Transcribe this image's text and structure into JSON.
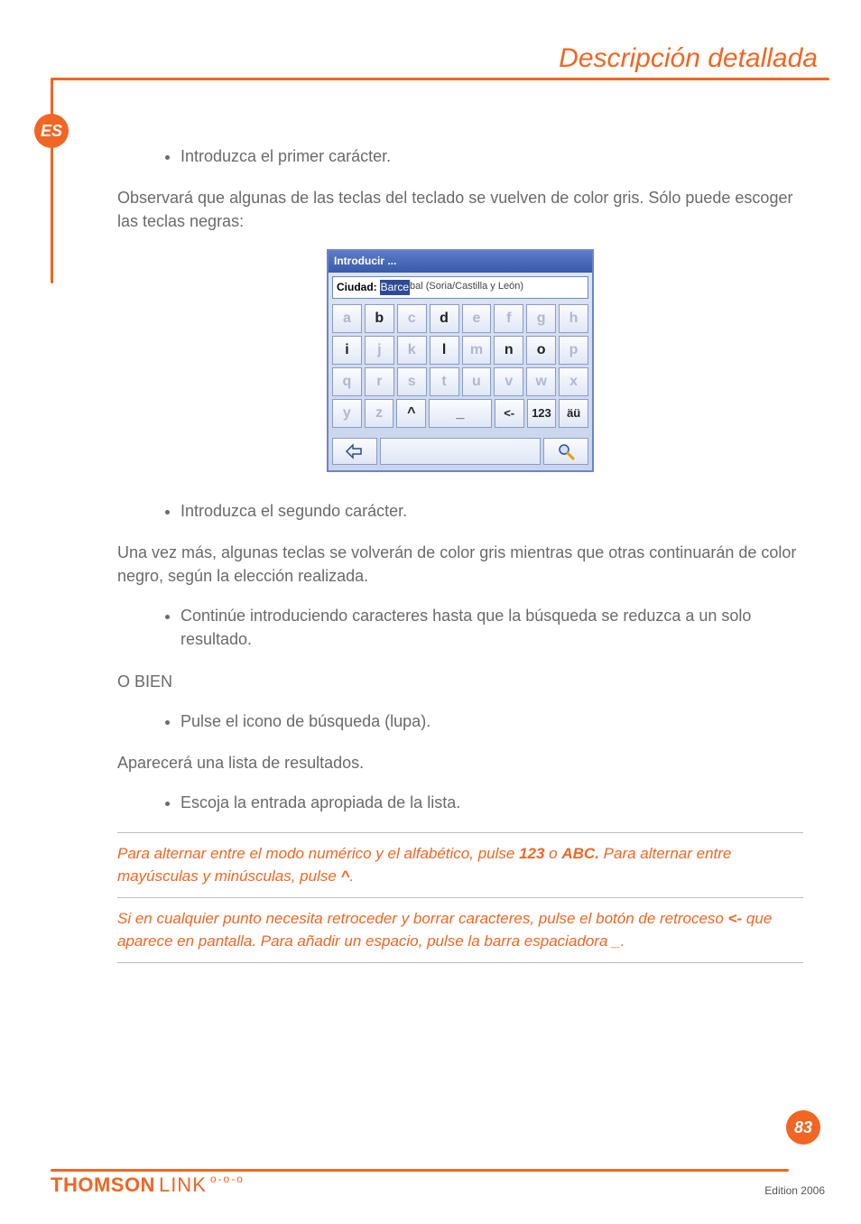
{
  "header": {
    "title": "Descripción detallada"
  },
  "lang_badge": "ES",
  "page_number": "83",
  "edition": "Edition 2006",
  "footer_logo": {
    "brand": "THOMSON",
    "sub": "LINK"
  },
  "content": {
    "bullet1": "Introduzca el primer carácter.",
    "para1": "Observará que algunas de las teclas del teclado se vuelven de color gris. Sólo puede escoger las teclas negras:",
    "bullet2": "Introduzca el segundo carácter.",
    "para2": "Una vez más, algunas teclas se volverán de color gris mientras que otras continuarán de color negro, según la elección realizada.",
    "bullet3": "Continúe introduciendo caracteres hasta que la búsqueda se reduzca a un solo resultado.",
    "or": "O BIEN",
    "bullet4": "Pulse el icono de búsqueda (lupa).",
    "para3": "Aparecerá una lista de resultados.",
    "bullet5": "Escoja la entrada apropiada de la lista.",
    "tip1_a": "Para alternar entre el modo numérico y el alfabético, pulse ",
    "tip1_b": "123",
    "tip1_c": " o ",
    "tip1_d": "ABC.",
    "tip1_e": " Para alternar entre mayúsculas y minúsculas, pulse ",
    "tip1_f": "^",
    "tip1_g": ".",
    "tip2_a": "Si en cualquier punto necesita retroceder y borrar caracteres, pulse el botón de retroceso ",
    "tip2_b": "<-",
    "tip2_c": " que aparece en pantalla. Para añadir un espacio, pulse la barra espaciadora _."
  },
  "keyboard": {
    "title": "Introducir ...",
    "field_label": "Ciudad:",
    "selected_text": "Barce",
    "rest_text": "bal (Soria/Castilla y León)",
    "rows": [
      [
        {
          "label": "a",
          "enabled": false
        },
        {
          "label": "b",
          "enabled": true
        },
        {
          "label": "c",
          "enabled": false
        },
        {
          "label": "d",
          "enabled": true
        },
        {
          "label": "e",
          "enabled": false
        },
        {
          "label": "f",
          "enabled": false
        },
        {
          "label": "g",
          "enabled": false
        },
        {
          "label": "h",
          "enabled": false
        }
      ],
      [
        {
          "label": "i",
          "enabled": true
        },
        {
          "label": "j",
          "enabled": false
        },
        {
          "label": "k",
          "enabled": false
        },
        {
          "label": "l",
          "enabled": true
        },
        {
          "label": "m",
          "enabled": false
        },
        {
          "label": "n",
          "enabled": true
        },
        {
          "label": "o",
          "enabled": true
        },
        {
          "label": "p",
          "enabled": false
        }
      ],
      [
        {
          "label": "q",
          "enabled": false
        },
        {
          "label": "r",
          "enabled": false
        },
        {
          "label": "s",
          "enabled": false
        },
        {
          "label": "t",
          "enabled": false
        },
        {
          "label": "u",
          "enabled": false
        },
        {
          "label": "v",
          "enabled": false
        },
        {
          "label": "w",
          "enabled": false
        },
        {
          "label": "x",
          "enabled": false
        }
      ]
    ],
    "row4": {
      "y": {
        "label": "y",
        "enabled": false
      },
      "z": {
        "label": "z",
        "enabled": false
      },
      "shift": {
        "label": "^",
        "enabled": true
      },
      "space": {
        "label": "_",
        "enabled": true
      },
      "back": {
        "label": "<-",
        "enabled": true
      },
      "num": {
        "label": "123",
        "enabled": true
      },
      "accent": {
        "label": "äü",
        "enabled": true
      }
    }
  }
}
